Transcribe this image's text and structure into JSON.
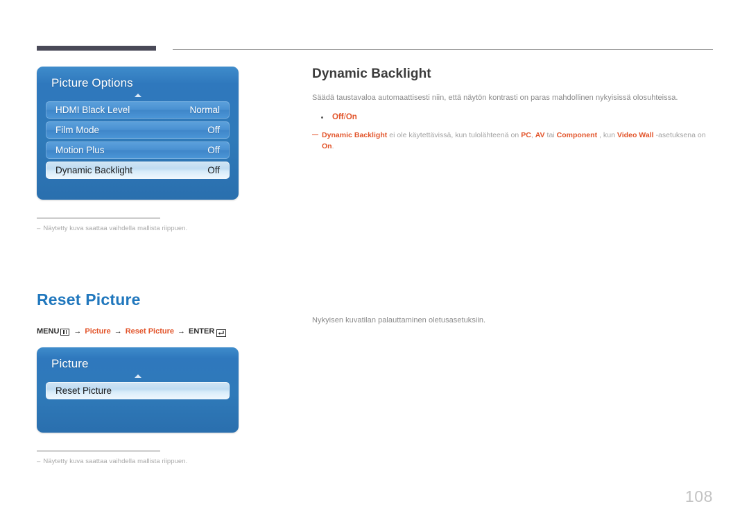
{
  "page": {
    "number": "108"
  },
  "section1": {
    "title": "Dynamic Backlight",
    "description": "Säädä taustavaloa automaattisesti niin, että näytön kontrasti on paras mahdollinen nykyisissä olosuhteissa.",
    "options": {
      "first": "Off",
      "separator": "/",
      "second": "On"
    },
    "note": {
      "part1": "Dynamic Backlight",
      "part2": " ei ole käytettävissä, kun tulolähteenä on ",
      "part3": "PC",
      "part4": ", ",
      "part5": "AV",
      "part6": " tai ",
      "part7": "Component",
      "part8": " , kun ",
      "part9": "Video Wall",
      "part10": " -asetuksena on ",
      "part11": "On",
      "part12": "."
    },
    "osd": {
      "title": "Picture Options",
      "rows": [
        {
          "label": "HDMI Black Level",
          "value": "Normal",
          "selected": false
        },
        {
          "label": "Film Mode",
          "value": "Off",
          "selected": false
        },
        {
          "label": "Motion Plus",
          "value": "Off",
          "selected": false
        },
        {
          "label": "Dynamic Backlight",
          "value": "Off",
          "selected": true
        }
      ]
    },
    "footnote": {
      "dash": "–",
      "text": "Näytetty kuva saattaa vaihdella mallista riippuen."
    }
  },
  "section2": {
    "title": "Reset Picture",
    "description": "Nykyisen kuvatilan palauttaminen oletusasetuksiin.",
    "breadcrumb": {
      "menu_label": "MENU",
      "menu_icon": "menu-grid-icon",
      "arrow": "→",
      "crumb1": "Picture",
      "crumb2": "Reset Picture",
      "enter_label": "ENTER",
      "enter_icon": "enter-return-icon"
    },
    "osd": {
      "title": "Picture",
      "rows": [
        {
          "label": "Reset Picture",
          "value": "",
          "selected": true
        }
      ]
    },
    "footnote": {
      "dash": "–",
      "text": "Näytetty kuva saattaa vaihdella mallista riippuen."
    }
  }
}
